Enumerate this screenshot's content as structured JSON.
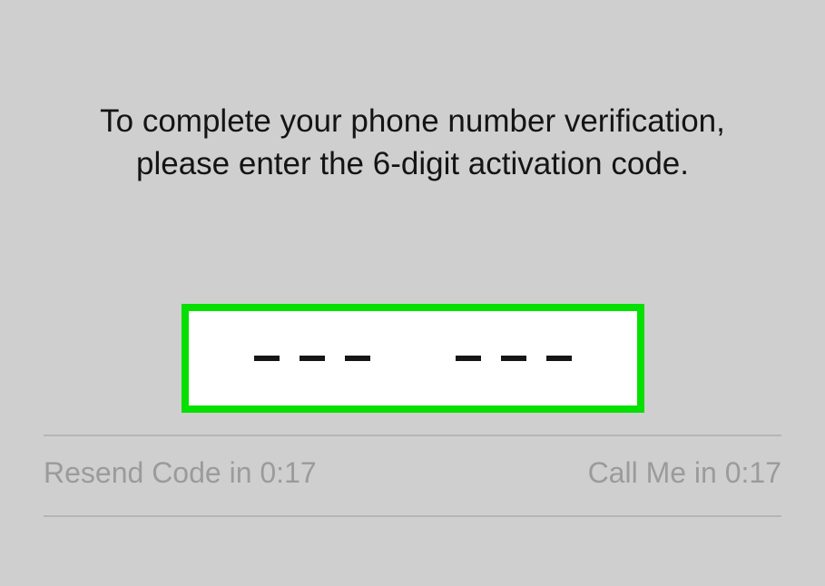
{
  "instruction": {
    "line1": "To complete your phone number verification,",
    "line2": "please enter the 6-digit activation code."
  },
  "codeInput": {
    "digits": [
      "",
      "",
      "",
      "",
      "",
      ""
    ]
  },
  "footer": {
    "resend": "Resend Code in 0:17",
    "callMe": "Call Me in 0:17"
  }
}
